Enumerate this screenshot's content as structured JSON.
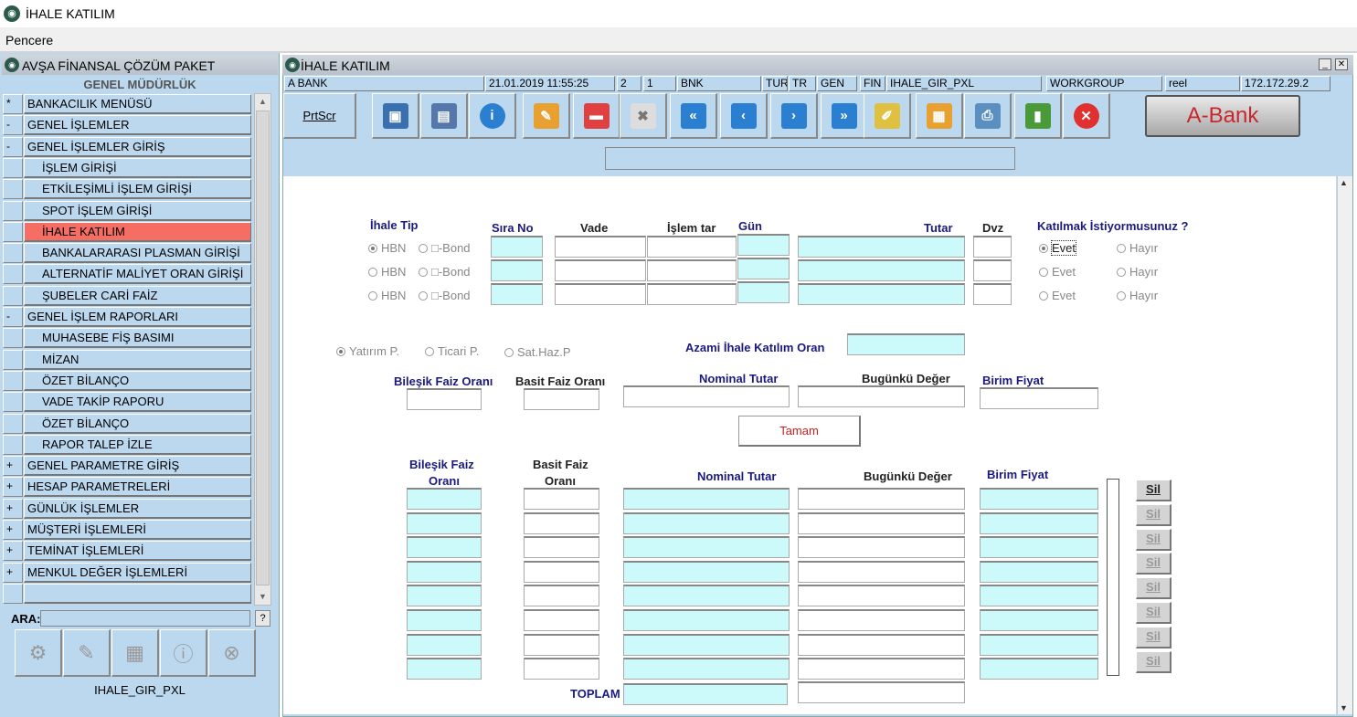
{
  "app": {
    "title": "İHALE KATILIM",
    "menu": "Pencere"
  },
  "left": {
    "title": "AVŞA FİNANSAL ÇÖZÜM PAKET",
    "subtitle": "GENEL MÜDÜRLÜK",
    "search_label": "ARA:",
    "search_help": "?",
    "footer": "IHALE_GIR_PXL",
    "items": [
      {
        "mark": "*",
        "label": "BANKACILIK MENÜSÜ"
      },
      {
        "mark": "-",
        "label": "GENEL İŞLEMLER"
      },
      {
        "mark": "-",
        "label": "GENEL İŞLEMLER GİRİŞ"
      },
      {
        "mark": "",
        "label": "İŞLEM GİRİŞİ"
      },
      {
        "mark": "",
        "label": "ETKİLEŞİMLİ İŞLEM GİRİŞİ"
      },
      {
        "mark": "",
        "label": "SPOT İŞLEM GİRİŞİ"
      },
      {
        "mark": "",
        "label": "İHALE KATILIM"
      },
      {
        "mark": "",
        "label": "BANKALARARASI PLASMAN GİRİŞİ"
      },
      {
        "mark": "",
        "label": "ALTERNATİF MALİYET ORAN GİRİŞİ"
      },
      {
        "mark": "",
        "label": "ŞUBELER CARİ FAİZ"
      },
      {
        "mark": "-",
        "label": "GENEL İŞLEM RAPORLARI"
      },
      {
        "mark": "",
        "label": "MUHASEBE FİŞ BASIMI"
      },
      {
        "mark": "",
        "label": "MİZAN"
      },
      {
        "mark": "",
        "label": "ÖZET BİLANÇO"
      },
      {
        "mark": "",
        "label": "VADE TAKİP RAPORU"
      },
      {
        "mark": "",
        "label": "ÖZET BİLANÇO"
      },
      {
        "mark": "",
        "label": "RAPOR TALEP İZLE"
      },
      {
        "mark": "+",
        "label": "GENEL PARAMETRE GİRİŞ"
      },
      {
        "mark": "+",
        "label": "HESAP PARAMETRELERİ"
      },
      {
        "mark": "+",
        "label": "GÜNLÜK İŞLEMLER"
      },
      {
        "mark": "+",
        "label": "MÜŞTERİ İŞLEMLERİ"
      },
      {
        "mark": "+",
        "label": "TEMİNAT İŞLEMLERİ"
      },
      {
        "mark": "+",
        "label": "MENKUL DEĞER İŞLEMLERİ"
      },
      {
        "mark": "",
        "label": ""
      }
    ]
  },
  "main": {
    "title": "İHALE KATILIM",
    "info": [
      "A BANK",
      "21.01.2019 11:55:25",
      "2",
      "1",
      "BNK",
      "TUR",
      "TR",
      "GEN",
      "FIN",
      "IHALE_GIR_PXL",
      "WORKGROUP",
      "reel",
      "172.172.29.2"
    ],
    "toolbar": {
      "prtscr": "PrtScr",
      "brand": "A-Bank"
    },
    "labels": {
      "ihale_tip": "İhale Tip",
      "sira_no": "Sıra No",
      "vade": "Vade",
      "islem_tar": "İşlem tar",
      "gun": "Gün",
      "tutar": "Tutar",
      "dvz": "Dvz",
      "katilmak": "Katılmak İstiyormusunuz ?",
      "azami": "Azami İhale Katılım Oran",
      "bilesik": "Bileşik Faiz Oranı",
      "basit": "Basit Faiz Oranı",
      "nominal": "Nominal Tutar",
      "bugunku": "Bugünkü Değer",
      "birim": "Birim Fiyat",
      "bilesik2a": "Bileşik Faiz",
      "bilesik2b": "Oranı",
      "basit2a": "Basit Faiz",
      "basit2b": "Oranı",
      "toplam": "TOPLAM",
      "tamam": "Tamam",
      "sil": "Sil"
    },
    "radios": {
      "hbn": "HBN",
      "bond": "□-Bond",
      "evet": "Evet",
      "hayir": "Hayır",
      "yatirim": "Yatırım P.",
      "ticari": "Ticari P.",
      "sathaz": "Sat.Haz.P"
    }
  },
  "colors": {
    "panel": "#bcd8ef",
    "selected": "#f66d63",
    "field": "#ccfafa",
    "label": "#1a1a80"
  }
}
